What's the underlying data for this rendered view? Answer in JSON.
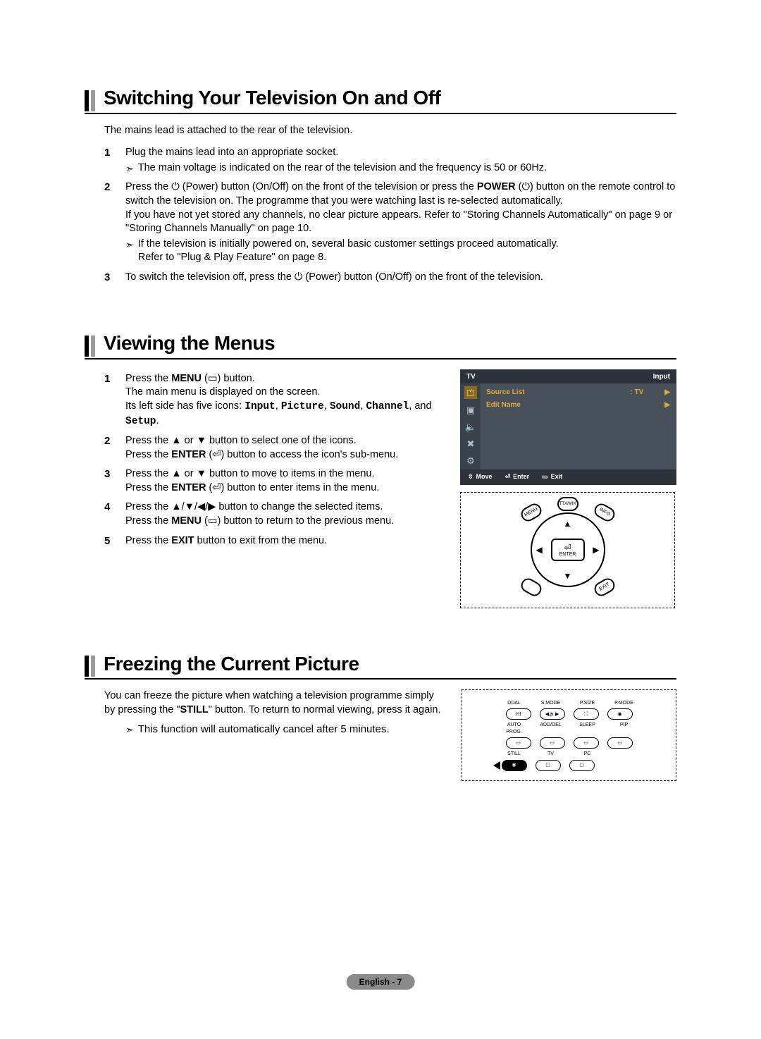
{
  "sections": {
    "switch": {
      "title": "Switching Your Television On and Off",
      "intro": "The mains lead is attached to the rear of the television.",
      "steps": {
        "s1": {
          "num": "1",
          "text": "Plug the mains lead into an appropriate socket.",
          "note": "The main voltage is indicated on the rear of the television and the frequency is 50 or 60Hz."
        },
        "s2": {
          "num": "2",
          "l1a": "Press the ",
          "l1b": " (Power) button (On/Off) on the front of the television or press the ",
          "power_word": "POWER",
          "l1c": " (",
          "l1d": ") button on the remote control to switch the television on. The programme that you were watching last is re-selected automatically.",
          "l2": "If you have not yet stored any channels, no clear picture appears. Refer to \"Storing Channels Automatically\" on page 9 or \"Storing Channels Manually\" on page 10.",
          "note1": "If the television is initially powered on, several basic customer settings proceed automatically.",
          "note2": "Refer to \"Plug & Play Feature\" on page 8."
        },
        "s3": {
          "num": "3",
          "a": "To switch the television off, press the ",
          "b": " (Power) button (On/Off) on the front of the television."
        }
      }
    },
    "menus": {
      "title": "Viewing the Menus",
      "steps": {
        "s1": {
          "num": "1",
          "a": "Press the ",
          "menu": "MENU",
          "b": " (",
          "c": ") button.",
          "line2": "The main menu is displayed on the screen.",
          "line3a": "Its left side has five icons: ",
          "i1": "Input",
          "i2": "Picture",
          "i3": "Sound",
          "i4": "Channel",
          "i5": "Setup",
          "line3b": "."
        },
        "s2": {
          "num": "2",
          "a": "Press the ▲ or ▼ button to select one of the icons.",
          "b1": "Press the ",
          "enter": "ENTER",
          "b2": " (",
          "b3": ") button to access the icon's sub-menu."
        },
        "s3": {
          "num": "3",
          "a": "Press the ▲ or ▼ button to move to items in the menu.",
          "b1": "Press the ",
          "enter": "ENTER",
          "b2": " (",
          "b3": ") button to enter items in the menu."
        },
        "s4": {
          "num": "4",
          "a": "Press the ▲/▼/◀/▶ button to change the selected items.",
          "b1": "Press the ",
          "menu": "MENU",
          "b2": " (",
          "b3": ") button to return to the previous menu."
        },
        "s5": {
          "num": "5",
          "a": "Press the ",
          "exit": "EXIT",
          "b": " button to exit from the menu."
        }
      },
      "osd": {
        "tv": "TV",
        "title": "Input",
        "row1": {
          "l": "Source List",
          "v": ": TV",
          "arrow": "▶"
        },
        "row2": {
          "l": "Edit Name",
          "arrow": "▶"
        },
        "foot": {
          "move": "Move",
          "enter": "Enter",
          "exit": "Exit"
        }
      },
      "remote": {
        "enter": "ENTER",
        "menu": "MENU",
        "ttx": "TTX/MIX",
        "info": "INFO",
        "exit": "EXIT"
      }
    },
    "freeze": {
      "title": "Freezing the Current Picture",
      "p1a": "You can freeze the picture when watching a television programme simply by pressing the \"",
      "still": "STILL",
      "p1b": "\" button. To return to normal viewing, press it again.",
      "note": "This function will automatically cancel after 5 minutes.",
      "btns": {
        "dual": "DUAL",
        "smode": "S.MODE",
        "psize": "P.SIZE",
        "pmode": "P.MODE",
        "auto": "AUTO PROG.",
        "add": "ADD/DEL",
        "sleep": "SLEEP",
        "pip": "PIP",
        "still_lbl": "STILL",
        "tv": "TV",
        "pc": "PC"
      }
    }
  },
  "footer": "English - 7",
  "glyph": {
    "power": "⏻",
    "menu_icon": "▭",
    "enter_icon": "⏎",
    "note_arrow": "➣",
    "updown": "⇳"
  }
}
